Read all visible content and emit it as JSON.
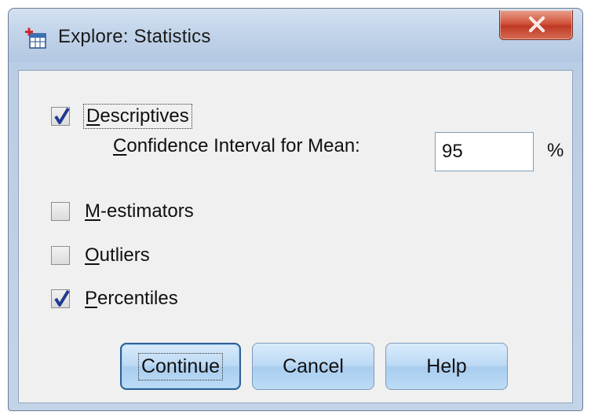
{
  "window": {
    "title": "Explore: Statistics",
    "close_glyph": "x"
  },
  "options": {
    "descriptives": {
      "label": "Descriptives",
      "checked": true
    },
    "confidence_interval": {
      "label": "Confidence Interval for Mean:",
      "value": "95",
      "unit": "%"
    },
    "m_estimators": {
      "label": "M-estimators",
      "checked": false
    },
    "outliers": {
      "label": "Outliers",
      "checked": false
    },
    "percentiles": {
      "label": "Percentiles",
      "checked": true
    }
  },
  "buttons": {
    "continue": "Continue",
    "cancel": "Cancel",
    "help": "Help"
  },
  "colors": {
    "check_mark": "#1f3a93",
    "close_button": "#c9462f",
    "button_face": "#bcd9f4"
  },
  "icons": {
    "app": "spss-table-icon",
    "close": "close-icon",
    "check": "check-icon"
  }
}
